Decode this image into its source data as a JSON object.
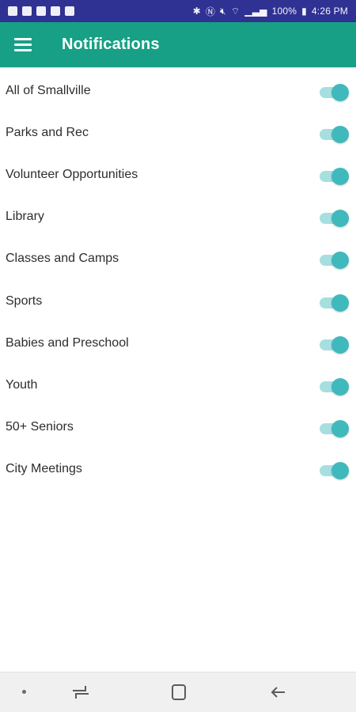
{
  "status_bar": {
    "battery": "100%",
    "time": "4:26 PM",
    "icons_left": [
      "facebook-icon",
      "message-icon",
      "image-icon",
      "notification-icon",
      "calendar-icon"
    ],
    "icons_right": [
      "bluetooth-icon",
      "nfc-icon",
      "mute-icon",
      "wifi-icon",
      "signal-icon",
      "battery-icon"
    ]
  },
  "app_bar": {
    "title": "Notifications",
    "menu_icon": "hamburger-menu-icon",
    "color": "#17a085"
  },
  "settings": [
    {
      "label": "All of Smallville",
      "enabled": true
    },
    {
      "label": "Parks and Rec",
      "enabled": true
    },
    {
      "label": "Volunteer Opportunities",
      "enabled": true
    },
    {
      "label": "Library",
      "enabled": true
    },
    {
      "label": "Classes and Camps",
      "enabled": true
    },
    {
      "label": "Sports",
      "enabled": true
    },
    {
      "label": "Babies and Preschool",
      "enabled": true
    },
    {
      "label": "Youth",
      "enabled": true
    },
    {
      "label": "50+ Seniors",
      "enabled": true
    },
    {
      "label": "City Meetings",
      "enabled": true
    }
  ],
  "toggle_colors": {
    "track_on": "#a7dfe0",
    "knob_on": "#40b9bd"
  },
  "nav_bar": {
    "buttons": [
      "recent-apps-icon",
      "home-icon",
      "back-icon"
    ]
  }
}
